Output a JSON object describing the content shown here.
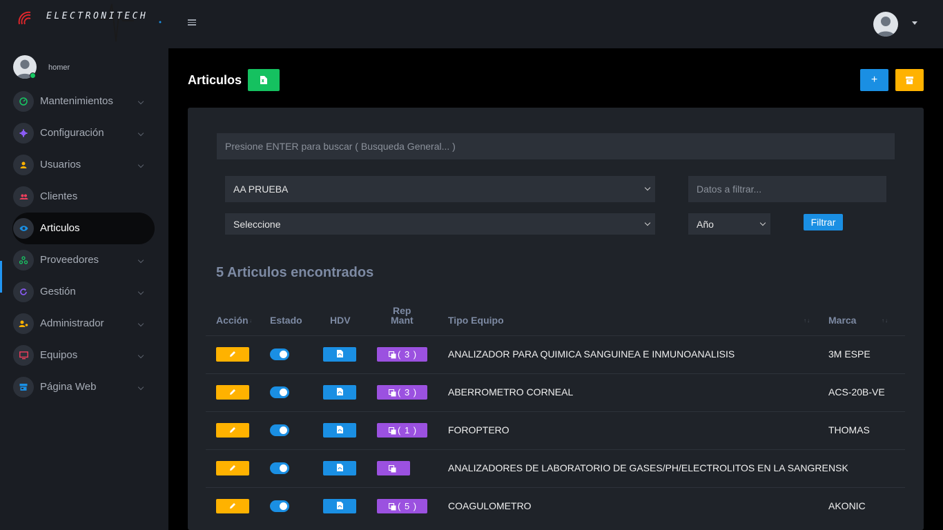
{
  "brand": {
    "logo_text": "ELECTRONITECH"
  },
  "user": {
    "name": "homer"
  },
  "sidebar": {
    "items": [
      {
        "label": "Mantenimientos",
        "icon": "gauge-icon",
        "color": "#17c964",
        "chevron": true
      },
      {
        "label": "Configuración",
        "icon": "gear-icon",
        "color": "#8b5cf6",
        "chevron": true
      },
      {
        "label": "Usuarios",
        "icon": "user-icon",
        "color": "#ffb200",
        "chevron": true
      },
      {
        "label": "Clientes",
        "icon": "users-icon",
        "color": "#f43f5e",
        "chevron": false
      },
      {
        "label": "Articulos",
        "icon": "eye-icon",
        "color": "#1a8fe3",
        "chevron": false,
        "active": true
      },
      {
        "label": "Proveedores",
        "icon": "network-icon",
        "color": "#17c964",
        "chevron": true
      },
      {
        "label": "Gestión",
        "icon": "refresh-icon",
        "color": "#8b5cf6",
        "chevron": true
      },
      {
        "label": "Administrador",
        "icon": "user-gear-icon",
        "color": "#ffb200",
        "chevron": true
      },
      {
        "label": "Equipos",
        "icon": "monitor-icon",
        "color": "#f43f5e",
        "chevron": true
      },
      {
        "label": "Página Web",
        "icon": "store-icon",
        "color": "#1a8fe3",
        "chevron": true
      }
    ]
  },
  "page": {
    "title": "Articulos"
  },
  "filters": {
    "search_placeholder": "Presione ENTER para buscar ( Busqueda General... )",
    "client_selected": "AA PRUEBA",
    "filter_placeholder": "Datos a filtrar...",
    "category_selected": "Seleccione",
    "year_selected": "Año",
    "filter_button": "Filtrar"
  },
  "results": {
    "count_label": "5 Articulos encontrados"
  },
  "table": {
    "headers": {
      "accion": "Acción",
      "estado": "Estado",
      "hdv": "HDV",
      "rep_1": "Rep",
      "rep_2": "Mant",
      "tipo": "Tipo Equipo",
      "marca": "Marca"
    },
    "rows": [
      {
        "rep_count": "( 3 )",
        "tipo": "ANALIZADOR PARA QUIMICA SANGUINEA E INMUNOANALISIS",
        "marca": "3M ESPE"
      },
      {
        "rep_count": "( 3 )",
        "tipo": "ABERROMETRO CORNEAL",
        "marca": "ACS-20B-VE"
      },
      {
        "rep_count": "( 1 )",
        "tipo": "FOROPTERO",
        "marca": "THOMAS"
      },
      {
        "rep_count": "",
        "tipo": "ANALIZADORES DE LABORATORIO DE GASES/PH/ELECTROLITOS EN LA SANGRE",
        "marca": "NSK"
      },
      {
        "rep_count": "( 5 )",
        "tipo": "COAGULOMETRO",
        "marca": "AKONIC"
      }
    ]
  },
  "colors": {
    "accent": "#1a8fe3",
    "warning": "#ffb200",
    "success": "#15c160",
    "purple": "#9b51e0"
  }
}
